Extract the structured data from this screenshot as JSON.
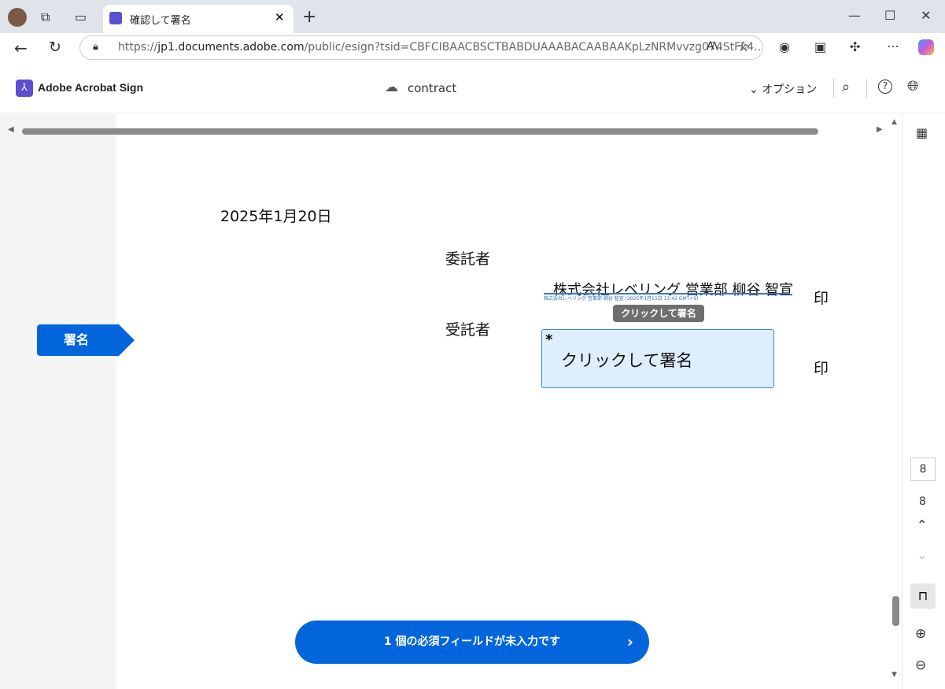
{
  "browser": {
    "tab_title": "確認して署名",
    "url_prefix": "https://",
    "url_host": "jp1.documents.adobe.com",
    "url_path": "/public/esign?tsid=CBFCIBAACBSCTBABDUAAABACAABAAKpLzNRMvvzg074StFk4..."
  },
  "header": {
    "brand": "Adobe Acrobat Sign",
    "doc_name": "contract",
    "options_label": "オプション"
  },
  "sidebar": {
    "sign_tag": "署名"
  },
  "document": {
    "date": "2025年1月20日",
    "consignor_label": "委託者",
    "consignor_signature": "株式会社レベリング 営業部 柳谷 智宣",
    "signature_caption": "株式会社レベリング 営業部 柳谷 智宣 (2025年1月15日 13:42 GMT+9)",
    "seal1": "印",
    "consignee_label": "受託者",
    "tooltip": "クリックして署名",
    "required_mark": "*",
    "sign_field_label": "クリックして署名",
    "seal2": "印"
  },
  "footer": {
    "required_button": "1 個の必須フィールドが未入力です"
  },
  "pager": {
    "current_page": "8",
    "total_pages": "8"
  },
  "colors": {
    "accent": "#0265dc",
    "field_bg": "#deeefc"
  }
}
